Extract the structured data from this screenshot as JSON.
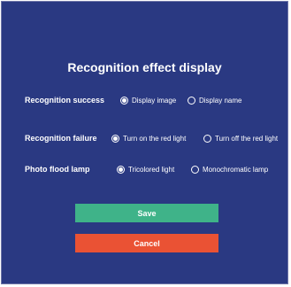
{
  "dialog": {
    "title": "Recognition effect display"
  },
  "rows": [
    {
      "label": "Recognition success",
      "options": [
        {
          "label": "Display image",
          "selected": true
        },
        {
          "label": "Display name",
          "selected": false
        }
      ]
    },
    {
      "label": "Recognition failure",
      "options": [
        {
          "label": "Turn on the red light",
          "selected": true
        },
        {
          "label": "Turn off the red light",
          "selected": false
        }
      ]
    },
    {
      "label": "Photo flood lamp",
      "options": [
        {
          "label": "Tricolored light",
          "selected": true
        },
        {
          "label": "Monochromatic lamp",
          "selected": false
        }
      ]
    }
  ],
  "buttons": {
    "save_label": "Save",
    "cancel_label": "Cancel"
  },
  "colors": {
    "background": "#2a3982",
    "save": "#3fb389",
    "cancel": "#ea5234"
  }
}
